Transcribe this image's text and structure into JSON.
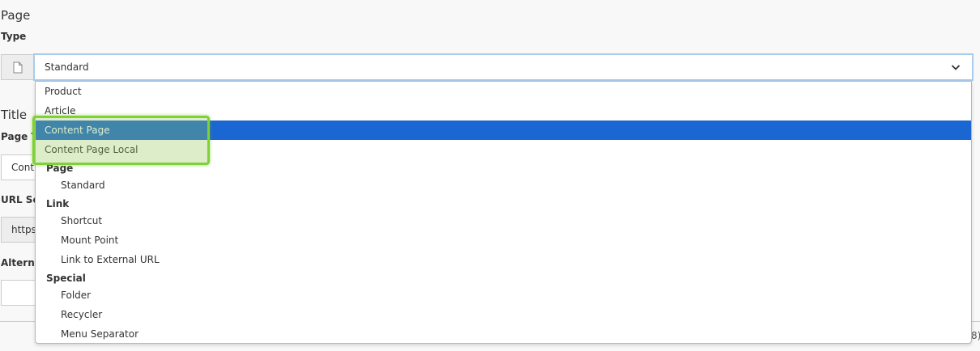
{
  "section_page": {
    "heading": "Page",
    "type_label": "Type"
  },
  "type_select": {
    "value": "Standard"
  },
  "section_title": {
    "heading": "Title",
    "page_title_label": "Page T",
    "page_title_value": "Cont",
    "url_segment_label": "URL Se",
    "url_value": "https",
    "alt_label": "Altern"
  },
  "edge_text": "8)",
  "dropdown": {
    "ungrouped": [
      "Product",
      "Article",
      "Content Page",
      "Content Page Local"
    ],
    "groups": [
      {
        "label": "Page",
        "items": [
          "Standard"
        ]
      },
      {
        "label": "Link",
        "items": [
          "Shortcut",
          "Mount Point",
          "Link to External URL"
        ]
      },
      {
        "label": "Special",
        "items": [
          "Folder",
          "Recycler",
          "Menu Separator"
        ]
      }
    ],
    "selected": "Content Page"
  },
  "colors": {
    "selected_bg": "#1a66d2",
    "focus_border": "#a9cbec",
    "highlight_border": "#7fd134"
  },
  "icons": {
    "type_addon": "page-icon",
    "select": "chevron-down-icon"
  }
}
